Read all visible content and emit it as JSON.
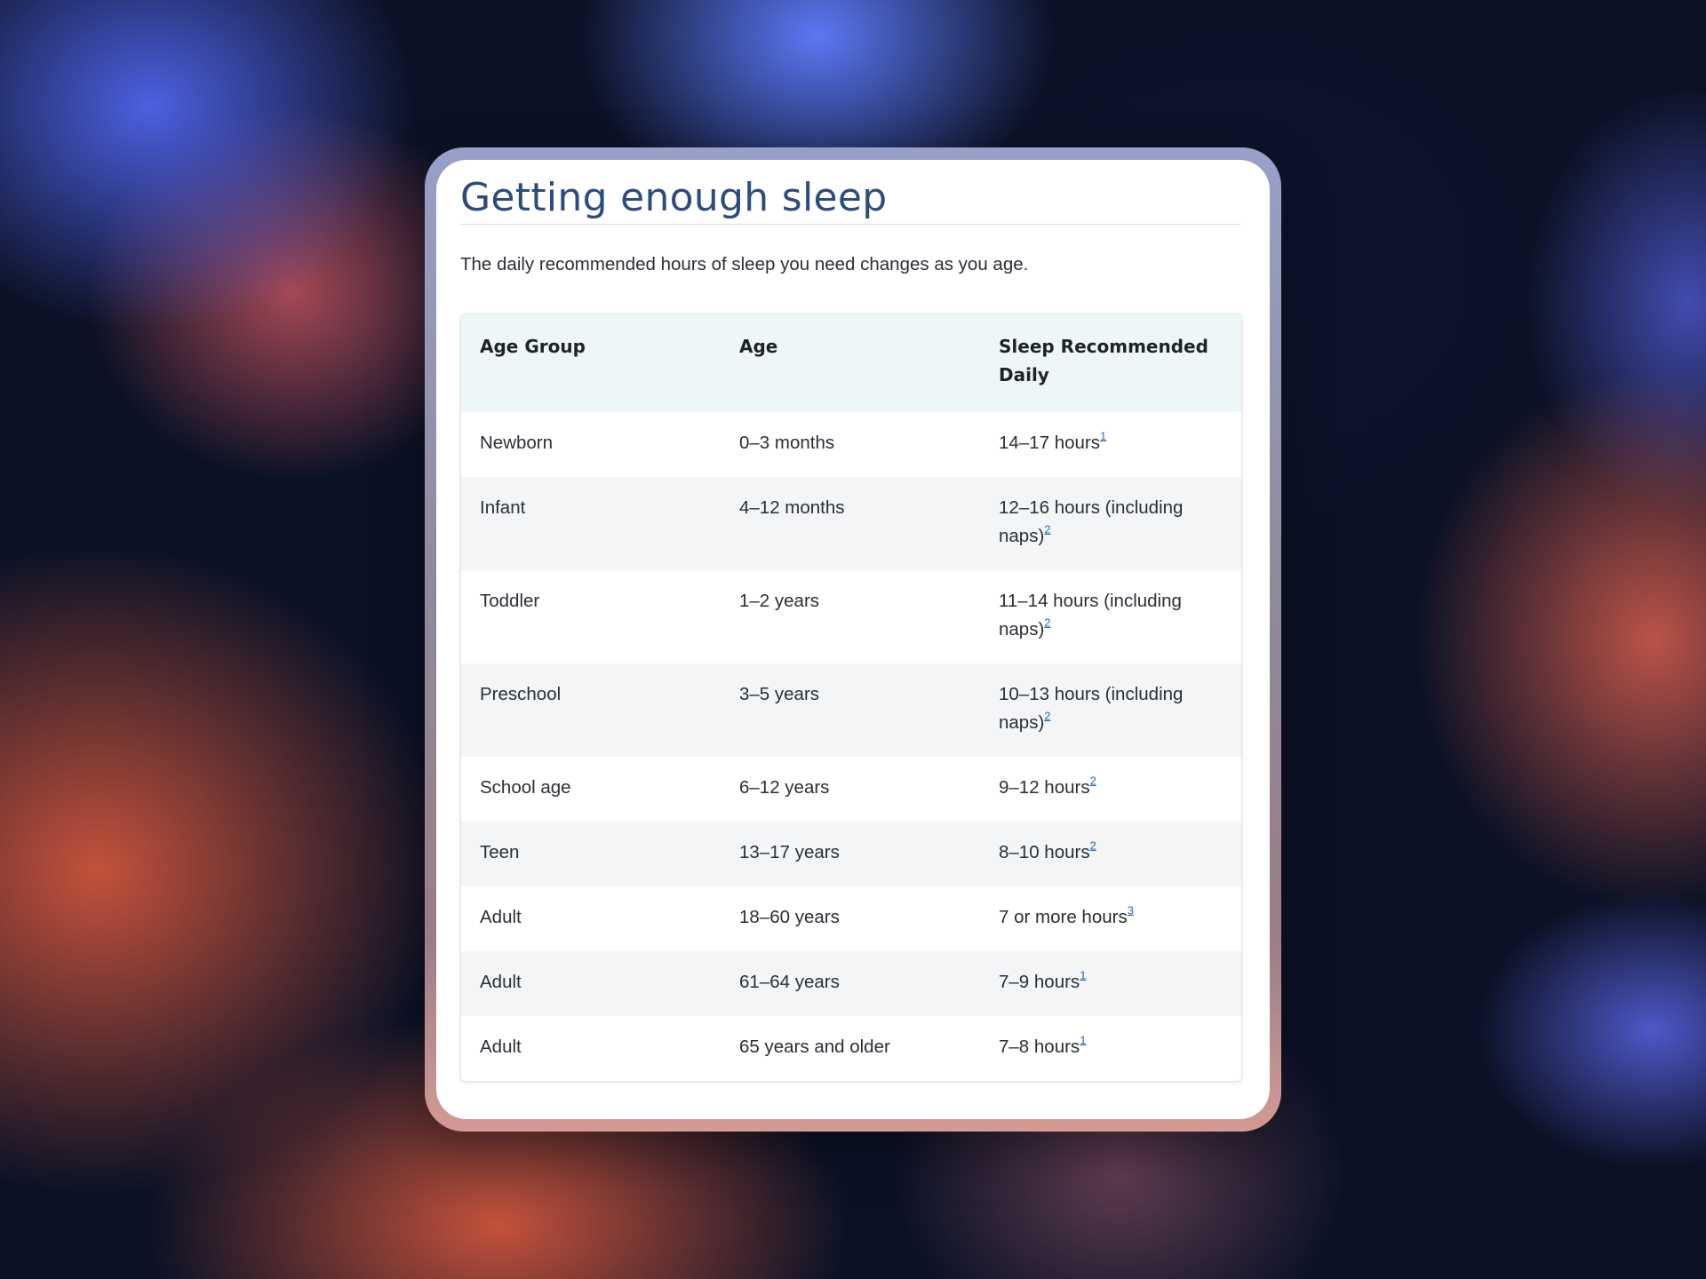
{
  "page": {
    "title": "Getting enough sleep",
    "intro": "The daily recommended hours of sleep you need changes as you age."
  },
  "table": {
    "headers": [
      "Age Group",
      "Age",
      "Sleep Recommended Daily"
    ],
    "rows": [
      {
        "group": "Newborn",
        "age": "0–3 months",
        "sleep": "14–17 hours",
        "ref": "1"
      },
      {
        "group": "Infant",
        "age": "4–12 months",
        "sleep": "12–16 hours (including naps)",
        "ref": "2"
      },
      {
        "group": "Toddler",
        "age": "1–2 years",
        "sleep": "11–14 hours (including naps)",
        "ref": "2"
      },
      {
        "group": "Preschool",
        "age": "3–5 years",
        "sleep": "10–13 hours (including naps)",
        "ref": "2"
      },
      {
        "group": "School age",
        "age": "6–12 years",
        "sleep": "9–12 hours",
        "ref": "2"
      },
      {
        "group": "Teen",
        "age": "13–17 years",
        "sleep": "8–10 hours",
        "ref": "2"
      },
      {
        "group": "Adult",
        "age": "18–60 years",
        "sleep": "7 or more hours",
        "ref": "3"
      },
      {
        "group": "Adult",
        "age": "61–64 years",
        "sleep": "7–9 hours",
        "ref": "1"
      },
      {
        "group": "Adult",
        "age": "65 years and older",
        "sleep": "7–8 hours",
        "ref": "1"
      }
    ]
  },
  "colors": {
    "title": "#2d4c7c",
    "header_bg": "#eef7f8",
    "stripe_bg": "#f4f5f6",
    "link": "#2d6ab0"
  }
}
